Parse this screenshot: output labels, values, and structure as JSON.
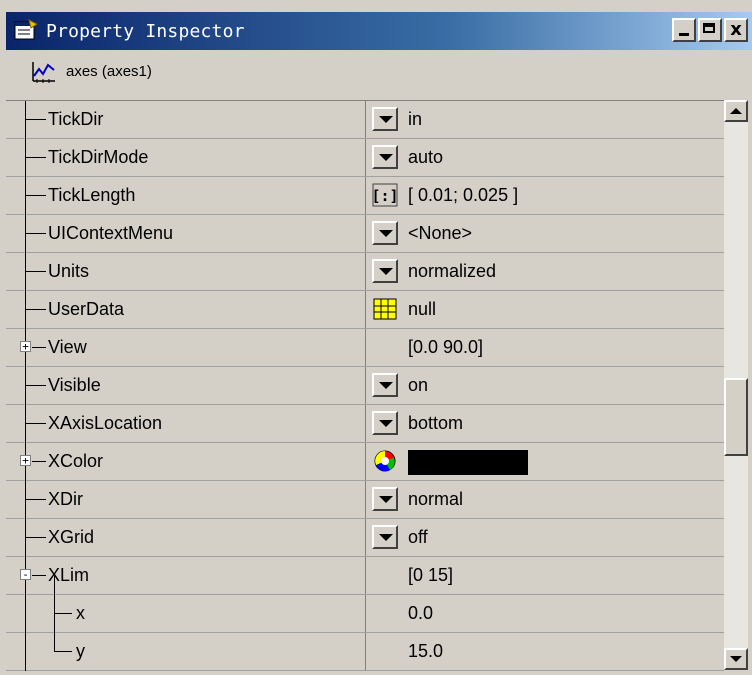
{
  "window": {
    "title": "Property Inspector",
    "close_glyph": "x"
  },
  "object_bar": {
    "label": "axes (axes1)",
    "icon": "axes-icon"
  },
  "colors": {
    "titlebar": "#0a246a",
    "xcolor_swatch": "#000000"
  },
  "properties": [
    {
      "name": "TickDir",
      "value": "in",
      "editor": "dropdown"
    },
    {
      "name": "TickDirMode",
      "value": "auto",
      "editor": "dropdown"
    },
    {
      "name": "TickLength",
      "value": "[ 0.01; 0.025 ]",
      "editor": "array"
    },
    {
      "name": "UIContextMenu",
      "value": "<None>",
      "editor": "dropdown"
    },
    {
      "name": "Units",
      "value": "normalized",
      "editor": "dropdown"
    },
    {
      "name": "UserData",
      "value": "null",
      "editor": "grid"
    },
    {
      "name": "View",
      "value": "[0.0 90.0]",
      "editor": "none",
      "expander": "+"
    },
    {
      "name": "Visible",
      "value": "on",
      "editor": "dropdown"
    },
    {
      "name": "XAxisLocation",
      "value": "bottom",
      "editor": "dropdown"
    },
    {
      "name": "XColor",
      "value": "",
      "editor": "color",
      "expander": "+"
    },
    {
      "name": "XDir",
      "value": "normal",
      "editor": "dropdown"
    },
    {
      "name": "XGrid",
      "value": "off",
      "editor": "dropdown"
    },
    {
      "name": "XLim",
      "value": "[0 15]",
      "editor": "none",
      "expander": "-"
    },
    {
      "name": "x",
      "value": "0.0",
      "editor": "none",
      "child": true
    },
    {
      "name": "y",
      "value": "15.0",
      "editor": "none",
      "child": true,
      "last": true
    }
  ]
}
